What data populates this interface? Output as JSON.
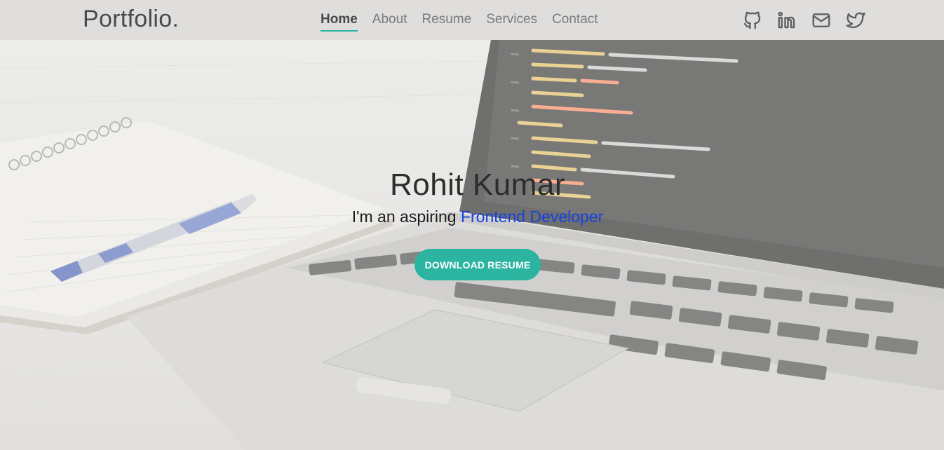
{
  "brand": {
    "name": "Portfolio."
  },
  "nav": {
    "items": [
      {
        "label": "Home",
        "active": true
      },
      {
        "label": "About",
        "active": false
      },
      {
        "label": "Resume",
        "active": false
      },
      {
        "label": "Services",
        "active": false
      },
      {
        "label": "Contact",
        "active": false
      }
    ]
  },
  "social": {
    "icons": [
      "github-icon",
      "linkedin-icon",
      "mail-icon",
      "twitter-icon"
    ]
  },
  "hero": {
    "name": "Rohit Kumar",
    "tagline_prefix": "I'm an aspiring ",
    "tagline_role": "Frontend Developer",
    "cta_label": "DOWNLOAD RESUME"
  },
  "colors": {
    "accent": "#2bb5a0",
    "role_text": "#1442e0",
    "navbar_bg": "#dfdedc"
  }
}
